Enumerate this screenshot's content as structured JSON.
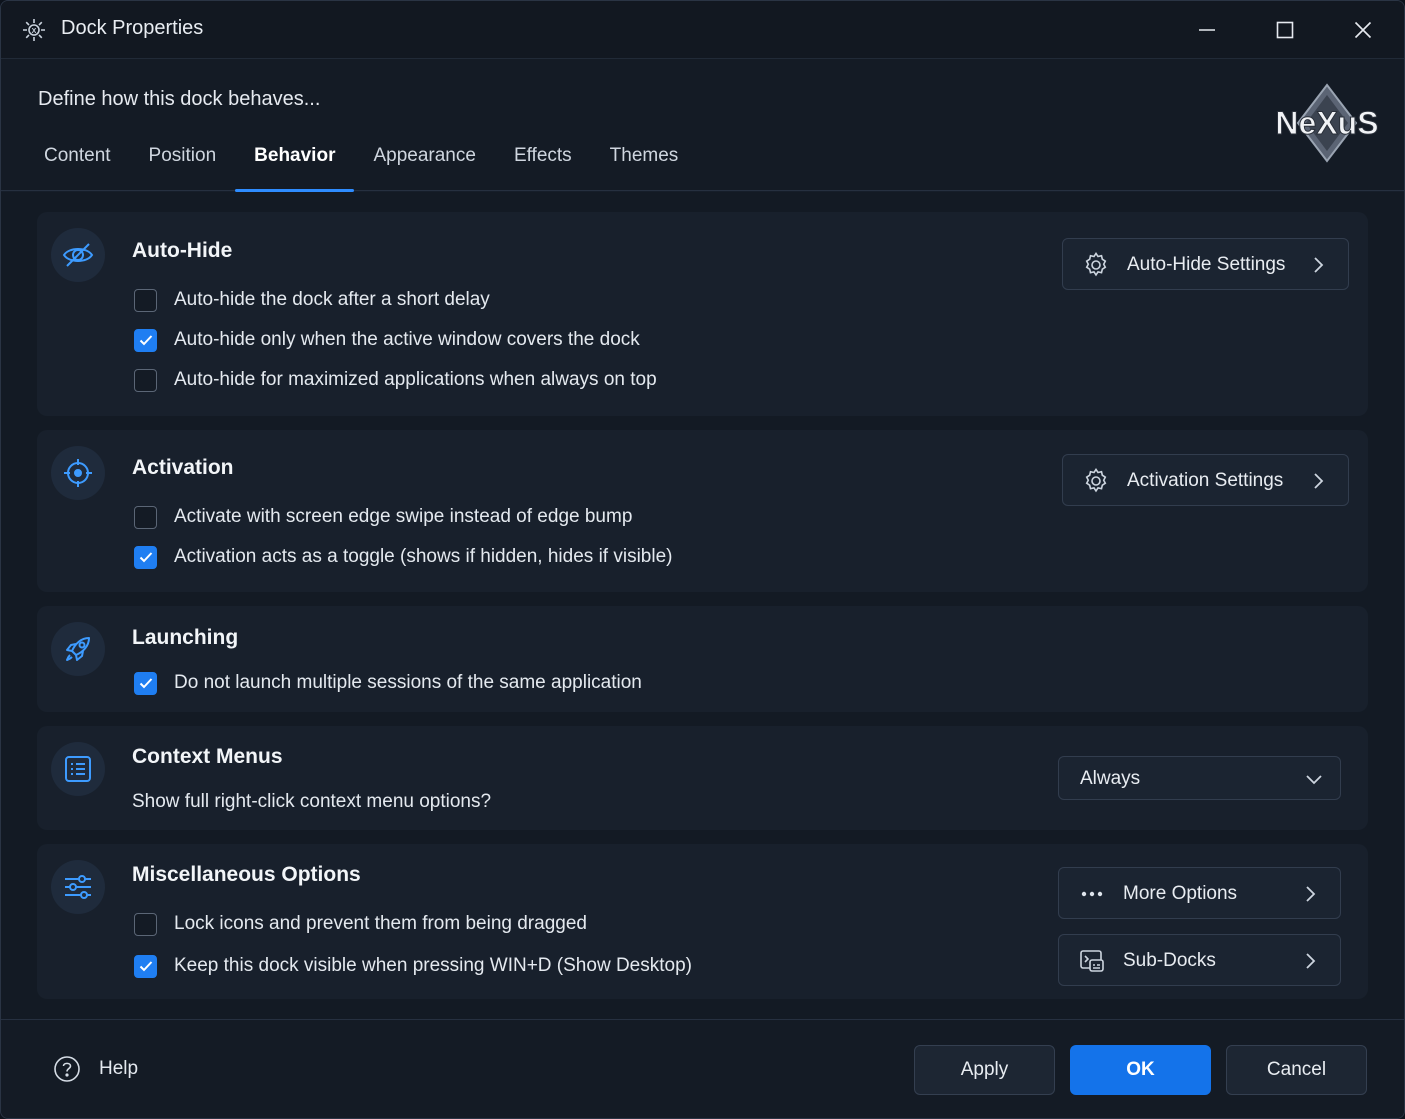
{
  "window": {
    "title": "Dock Properties"
  },
  "header": {
    "subtitle": "Define how this dock behaves...",
    "logo_text": "NeXuS",
    "tabs": [
      {
        "label": "Content",
        "active": false
      },
      {
        "label": "Position",
        "active": false
      },
      {
        "label": "Behavior",
        "active": true
      },
      {
        "label": "Appearance",
        "active": false
      },
      {
        "label": "Effects",
        "active": false
      },
      {
        "label": "Themes",
        "active": false
      }
    ]
  },
  "sections": {
    "autohide": {
      "title": "Auto-Hide",
      "icon": "eye-slash-icon",
      "button": "Auto-Hide Settings",
      "options": [
        {
          "label": "Auto-hide the dock after a short delay",
          "checked": false
        },
        {
          "label": "Auto-hide only when the active window covers the dock",
          "checked": true
        },
        {
          "label": "Auto-hide for maximized applications when always on top",
          "checked": false
        }
      ]
    },
    "activation": {
      "title": "Activation",
      "icon": "crosshair-icon",
      "button": "Activation Settings",
      "options": [
        {
          "label": "Activate with screen edge swipe instead of edge bump",
          "checked": false
        },
        {
          "label": "Activation acts as a toggle (shows if hidden, hides if visible)",
          "checked": true
        }
      ]
    },
    "launching": {
      "title": "Launching",
      "icon": "rocket-icon",
      "options": [
        {
          "label": "Do not launch multiple sessions of the same application",
          "checked": true
        }
      ]
    },
    "context": {
      "title": "Context Menus",
      "icon": "list-icon",
      "question": "Show full right-click context menu options?",
      "select_value": "Always"
    },
    "misc": {
      "title": "Miscellaneous Options",
      "icon": "sliders-icon",
      "more_button": "More Options",
      "subdocks_button": "Sub-Docks",
      "options": [
        {
          "label": "Lock icons and prevent them from being dragged",
          "checked": false
        },
        {
          "label": "Keep this dock visible when pressing WIN+D (Show Desktop)",
          "checked": true
        }
      ]
    }
  },
  "footer": {
    "help": "Help",
    "apply": "Apply",
    "ok": "OK",
    "cancel": "Cancel"
  },
  "colors": {
    "accent": "#1f7ef2",
    "primary_button": "#1473ea",
    "window_bg": "#161e2a",
    "section_bg": "#18202c"
  }
}
